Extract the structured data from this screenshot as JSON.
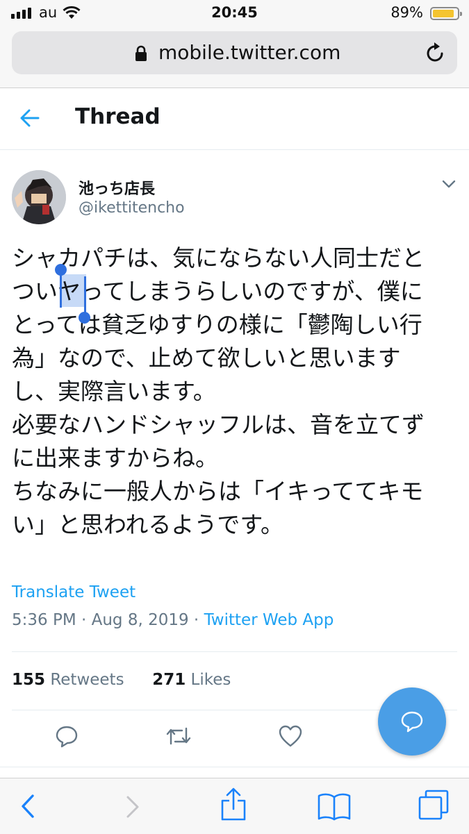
{
  "status_bar": {
    "carrier": "au",
    "time": "20:45",
    "battery": "89%",
    "battery_level": 0.89
  },
  "browser": {
    "url": "mobile.twitter.com"
  },
  "header": {
    "title": "Thread"
  },
  "tweet": {
    "display_name": "池っち店長",
    "handle": "@ikettitencho",
    "text": "シャカパチは、気にならない人同士だと\nついヤってしまうらしいのですが、僕に\nとっては貧乏ゆすりの様に「鬱陶しい行\n為」なので、止めて欲しいと思います\nし、実際言います。\n必要なハンドシャッフルは、音を立てず\nに出来ますからね。\nちなみに一般人からは「イキっててキモ\nい」と思われるようです。",
    "selected_text": "ヤ",
    "translate_label": "Translate Tweet",
    "timestamp": "5:36 PM · Aug 8, 2019 · ",
    "source": "Twitter Web App",
    "retweets_count": "155",
    "retweets_label": " Retweets",
    "likes_count": "271",
    "likes_label": " Likes"
  },
  "colors": {
    "accent": "#1da1f2",
    "fab": "#4a9ee6",
    "safari_blue": "#1a82fb",
    "secondary_text": "#657786"
  },
  "icons": {
    "back": "arrow-left-icon",
    "lock": "lock-icon",
    "reload": "reload-icon",
    "caret": "chevron-down-icon",
    "reply": "reply-icon",
    "retweet": "retweet-icon",
    "like": "heart-icon",
    "compose": "compose-icon",
    "safari_back": "chevron-left-icon",
    "safari_forward": "chevron-right-icon",
    "share": "share-icon",
    "bookmarks": "book-icon",
    "tabs": "tabs-icon"
  }
}
